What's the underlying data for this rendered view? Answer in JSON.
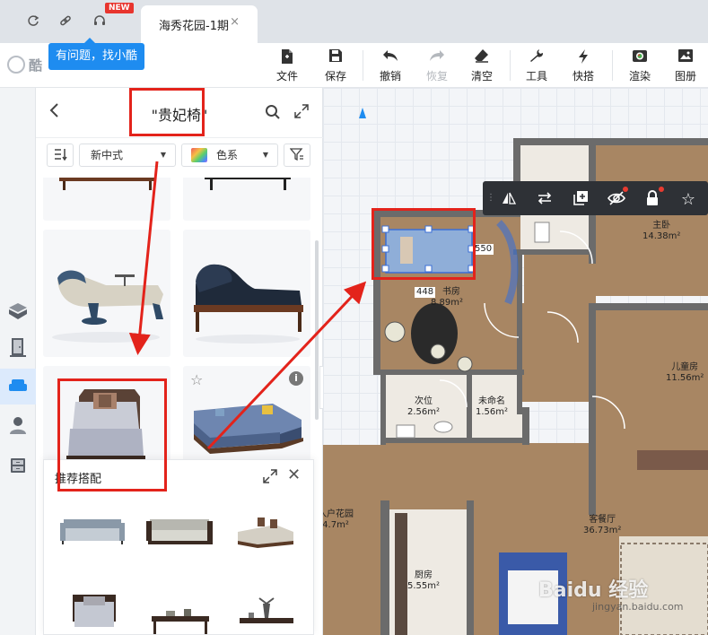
{
  "browser": {
    "new_badge": "NEW",
    "tab_title": "海秀花园-1期",
    "tab_close": "×"
  },
  "app": {
    "logo_text": "酷",
    "help_tip": "有问题，找小酷"
  },
  "toolbar": {
    "items": [
      {
        "label": "文件",
        "icon": "file-icon"
      },
      {
        "label": "保存",
        "icon": "save-icon"
      },
      {
        "label": "撤销",
        "icon": "undo-icon"
      },
      {
        "label": "恢复",
        "icon": "redo-icon",
        "disabled": true
      },
      {
        "label": "清空",
        "icon": "eraser-icon"
      },
      {
        "label": "工具",
        "icon": "wrench-icon"
      },
      {
        "label": "快搭",
        "icon": "lightning-icon"
      },
      {
        "label": "渲染",
        "icon": "render-icon"
      },
      {
        "label": "图册",
        "icon": "album-icon"
      }
    ]
  },
  "panel": {
    "search_term": "\"贵妃椅\"",
    "style_filter": "新中式",
    "color_filter": "色系"
  },
  "recommend": {
    "title": "推荐搭配"
  },
  "canvas": {
    "dimension_a": "448",
    "dimension_b": "550",
    "rooms": [
      {
        "name": "主卧",
        "area": "14.38m²"
      },
      {
        "name": "书房",
        "area": "8.89m²"
      },
      {
        "name": "儿童房",
        "area": "11.56m²"
      },
      {
        "name": "次位",
        "area": "2.56m²"
      },
      {
        "name": "未命名",
        "area": "1.56m²"
      },
      {
        "name": "入户花园",
        "area": "4.7m²"
      },
      {
        "name": "客餐厅",
        "area": "36.73m²"
      },
      {
        "name": "厨房",
        "area": "5.55m²"
      }
    ]
  },
  "watermark": {
    "text": "Baidu 经验",
    "sub": "jingyan.baidu.com"
  },
  "colors": {
    "accent": "#1e8cf0",
    "annotation": "#e3231b",
    "wall": "#6b6b6b",
    "floor_wood": "#a88663",
    "floor_tile": "#eeeae3"
  }
}
